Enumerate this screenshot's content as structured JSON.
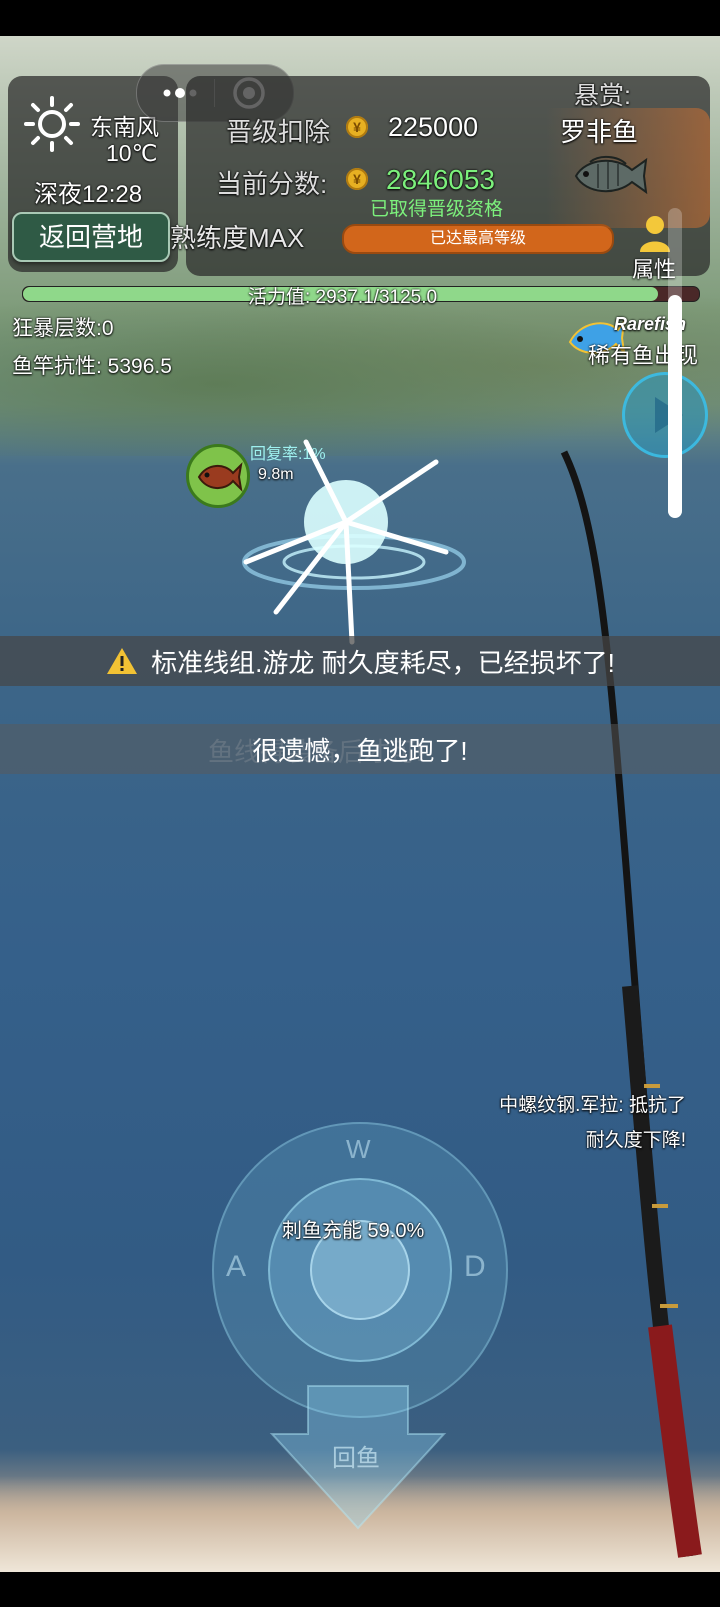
{
  "weather": {
    "icon": "sun-icon",
    "wind": "东南风",
    "temperature": "10℃",
    "time": "深夜12:28"
  },
  "buttons": {
    "return_camp": "返回营地",
    "attributes": "属性"
  },
  "mini_program": {
    "menu_icon": "more-dots-icon",
    "close_icon": "target-close-icon"
  },
  "upgrade": {
    "deduct_label": "晋级扣除",
    "deduct_value": "225000",
    "score_label": "当前分数:",
    "score_value": "2846053",
    "qualified": "已取得晋级资格",
    "proficiency": "熟练度MAX",
    "max_level": "已达最高等级",
    "coin_symbol": "¥"
  },
  "bounty": {
    "label": "悬赏:",
    "fish": "罗非鱼"
  },
  "vitality": {
    "text": "活力值: 2937.1/3125.0",
    "fraction": 0.94
  },
  "stats": {
    "rage": "狂暴层数:0",
    "rod_resist": "鱼竿抗性: 5396.5"
  },
  "rare_fish": {
    "logo": "Rarefish",
    "text": "稀有鱼出现"
  },
  "fish_status": {
    "recovery": "回复率:1%",
    "distance": "9.8m"
  },
  "messages": {
    "line_broken": "标准线组.游龙 耐久度耗尽，已经损坏了!",
    "fish_escaped": "很遗憾，鱼逃跑了!",
    "ghost_text": "鱼线得装备后才可!"
  },
  "notice": {
    "line1": "中螺纹钢.军拉: 抵抗了",
    "line2": "耐久度下降!"
  },
  "joystick": {
    "charge": "刺鱼充能 59.0%",
    "up": "W",
    "left": "A",
    "right": "D",
    "reel": "回鱼"
  },
  "side_slider": {
    "level": 0.72
  },
  "colors": {
    "accent_green": "#7cf07c",
    "progress_orange": "#d2661b",
    "button_green": "#2f5a45",
    "vitality_green": "#8fd88a"
  }
}
